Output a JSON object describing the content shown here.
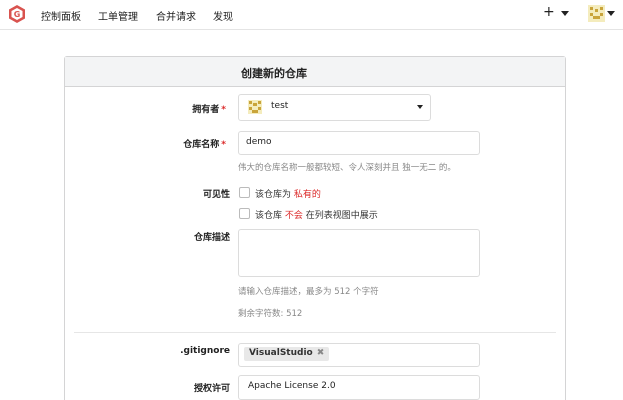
{
  "nav": {
    "links": [
      "控制面板",
      "工单管理",
      "合并请求",
      "发现"
    ],
    "plus": "+"
  },
  "form": {
    "title": "创建新的仓库",
    "owner": {
      "label": "拥有者",
      "required": "*",
      "value": "test"
    },
    "repo_name": {
      "label": "仓库名称",
      "required": "*",
      "value": "demo",
      "help": "伟大的仓库名称一般都较短、令人深刻并且 独一无二 的。"
    },
    "visibility": {
      "label": "可见性",
      "private_prefix": "该仓库为",
      "private_word": "私有的",
      "template_prefix": "该仓库",
      "template_word": "不会",
      "template_suffix": "在列表视图中展示"
    },
    "description": {
      "label": "仓库描述",
      "help": "请输入仓库描述，最多为 512 个字符",
      "remaining": "剩余字符数: 512"
    },
    "gitignore": {
      "label": ".gitignore",
      "tag": "VisualStudio",
      "remove": "✖"
    },
    "license": {
      "label": "授权许可",
      "value": "Apache License 2.0"
    }
  },
  "colors": {
    "required": "#db2828",
    "accent": "#db2828"
  }
}
